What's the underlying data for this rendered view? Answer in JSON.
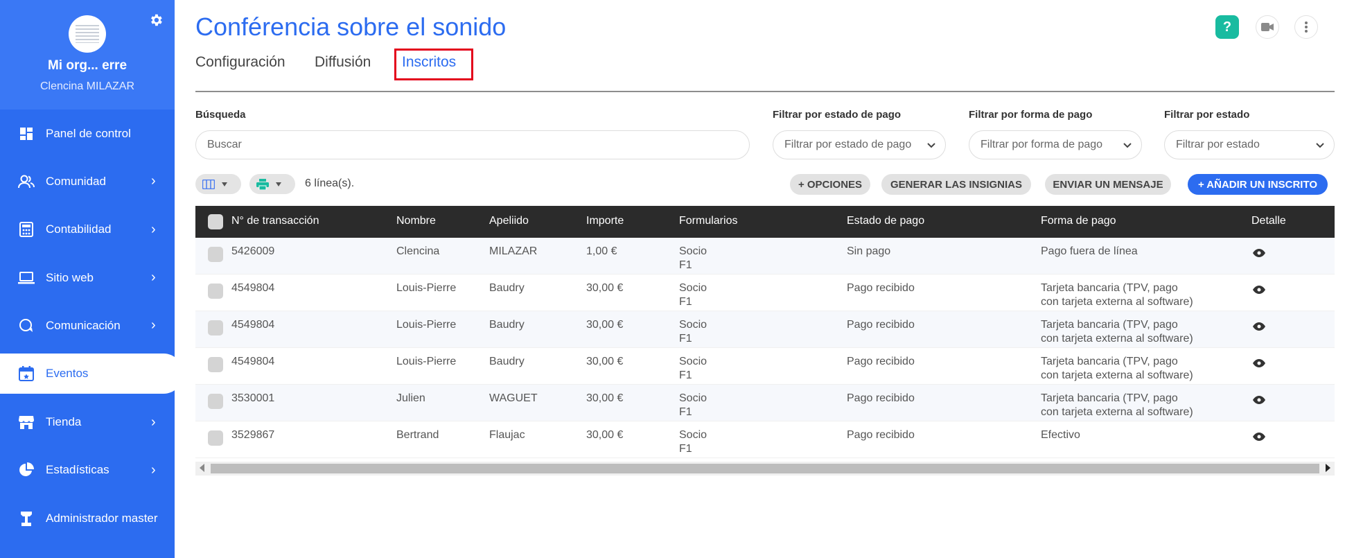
{
  "sidebar": {
    "org_name": "Mi org... erre",
    "user_name": "Clencina MILAZAR",
    "items": [
      {
        "label": "Panel de control",
        "icon": "dashboard-icon",
        "has_chevron": false
      },
      {
        "label": "Comunidad",
        "icon": "community-icon",
        "has_chevron": true
      },
      {
        "label": "Contabilidad",
        "icon": "calculator-icon",
        "has_chevron": true
      },
      {
        "label": "Sitio web",
        "icon": "laptop-icon",
        "has_chevron": true
      },
      {
        "label": "Comunicación",
        "icon": "chat-icon",
        "has_chevron": true
      },
      {
        "label": "Eventos",
        "icon": "calendar-icon",
        "has_chevron": false,
        "active": true
      },
      {
        "label": "Tienda",
        "icon": "store-icon",
        "has_chevron": true
      },
      {
        "label": "Estadísticas",
        "icon": "pie-chart-icon",
        "has_chevron": true
      },
      {
        "label": "Administrador master",
        "icon": "admin-icon",
        "has_chevron": false
      }
    ]
  },
  "header": {
    "title": "Conférencia sobre el sonido",
    "tabs": [
      "Configuración",
      "Diffusión",
      "Inscritos"
    ],
    "active_tab": "Inscritos"
  },
  "filters": {
    "search_label": "Búsqueda",
    "search_placeholder": "Buscar",
    "payment_status_label": "Filtrar por estado de pago",
    "payment_status_placeholder": "Filtrar por estado de pago",
    "payment_method_label": "Filtrar por forma de pago",
    "payment_method_placeholder": "Filtrar por forma de pago",
    "status_label": "Filtrar por estado",
    "status_placeholder": "Filtrar por estado"
  },
  "toolbar": {
    "lines_count": "6 línea(s).",
    "options_label": "+ OPCIONES",
    "badges_label": "GENERAR LAS INSIGNIAS",
    "message_label": "ENVIAR UN MENSAJE",
    "add_label": "+ AÑADIR UN INSCRITO"
  },
  "table": {
    "columns": [
      "N° de transacción",
      "Nombre",
      "Apeliido",
      "Importe",
      "Formularios",
      "Estado de pago",
      "Forma de pago",
      "Detalle"
    ],
    "rows": [
      {
        "transaction": "5426009",
        "first_name": "Clencina",
        "last_name": "MILAZAR",
        "amount": "1,00 €",
        "form_line1": "Socio",
        "form_line2": "F1",
        "payment_status": "Sin pago",
        "method_line1": "Pago fuera de línea",
        "method_line2": ""
      },
      {
        "transaction": "4549804",
        "first_name": "Louis-Pierre",
        "last_name": "Baudry",
        "amount": "30,00 €",
        "form_line1": "Socio",
        "form_line2": "F1",
        "payment_status": "Pago recibido",
        "method_line1": "Tarjeta bancaria (TPV, pago",
        "method_line2": "con tarjeta externa al software)"
      },
      {
        "transaction": "4549804",
        "first_name": "Louis-Pierre",
        "last_name": "Baudry",
        "amount": "30,00 €",
        "form_line1": "Socio",
        "form_line2": "F1",
        "payment_status": "Pago recibido",
        "method_line1": "Tarjeta bancaria (TPV, pago",
        "method_line2": "con tarjeta externa al software)"
      },
      {
        "transaction": "4549804",
        "first_name": "Louis-Pierre",
        "last_name": "Baudry",
        "amount": "30,00 €",
        "form_line1": "Socio",
        "form_line2": "F1",
        "payment_status": "Pago recibido",
        "method_line1": "Tarjeta bancaria (TPV, pago",
        "method_line2": "con tarjeta externa al software)"
      },
      {
        "transaction": "3530001",
        "first_name": "Julien",
        "last_name": "WAGUET",
        "amount": "30,00 €",
        "form_line1": "Socio",
        "form_line2": "F1",
        "payment_status": "Pago recibido",
        "method_line1": "Tarjeta bancaria (TPV, pago",
        "method_line2": "con tarjeta externa al software)"
      },
      {
        "transaction": "3529867",
        "first_name": "Bertrand",
        "last_name": "Flaujac",
        "amount": "30,00 €",
        "form_line1": "Socio",
        "form_line2": "F1",
        "payment_status": "Pago recibido",
        "method_line1": "Efectivo",
        "method_line2": ""
      }
    ]
  },
  "colors": {
    "primary": "#2c6cf0",
    "sidebar": "#2c6cf0",
    "header_row": "#2b2b2b",
    "highlight_box": "#e3001b",
    "help_button": "#19bba0"
  }
}
